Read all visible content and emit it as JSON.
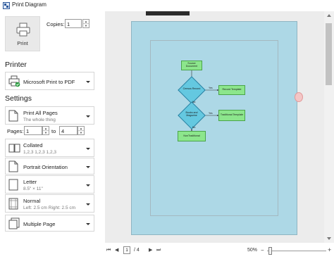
{
  "window": {
    "title": "Print Diagram"
  },
  "print_button": {
    "label": "Print"
  },
  "copies": {
    "label": "Copies:",
    "value": "1"
  },
  "printer": {
    "section_title": "Printer",
    "selected": "Microsoft Print to PDF"
  },
  "settings": {
    "section_title": "Settings",
    "range": {
      "title": "Print All Pages",
      "subtitle": "The whole thing"
    },
    "pages": {
      "label": "Pages:",
      "from": "1",
      "to_label": "to",
      "to": "4"
    },
    "collation": {
      "title": "Collated",
      "subtitle": "1,2,3    1,2,3    1,2,3"
    },
    "orientation": {
      "title": "Portrait Orientation"
    },
    "paper": {
      "title": "Letter",
      "subtitle": "8.5\" × 11\""
    },
    "margins": {
      "title": "Normal",
      "subtitle": "Left: 2.5 cm  Right: 2.5 cm"
    },
    "pages_per_sheet": {
      "title": "Multiple Page"
    }
  },
  "diagram": {
    "background": "#add8e6",
    "nodes": {
      "source_document": "Source Document",
      "census_record": "Census Record",
      "record_template": "Record Template",
      "books_magazine": "Books and Magazine",
      "traditional_template": "Traditional Template",
      "non_traditional": "NonTraditional"
    },
    "edge_labels": {
      "yes1": "Yes",
      "no1": "No",
      "yes2": "Yes",
      "no2": "No"
    }
  },
  "pager": {
    "current": "1",
    "of": "/ 4"
  },
  "zoom": {
    "level": "50%",
    "fraction": 0.5
  },
  "colors": {
    "process_fill": "#8ce68c",
    "decision_fill": "#64c8e0",
    "accent": "#2b579a"
  }
}
